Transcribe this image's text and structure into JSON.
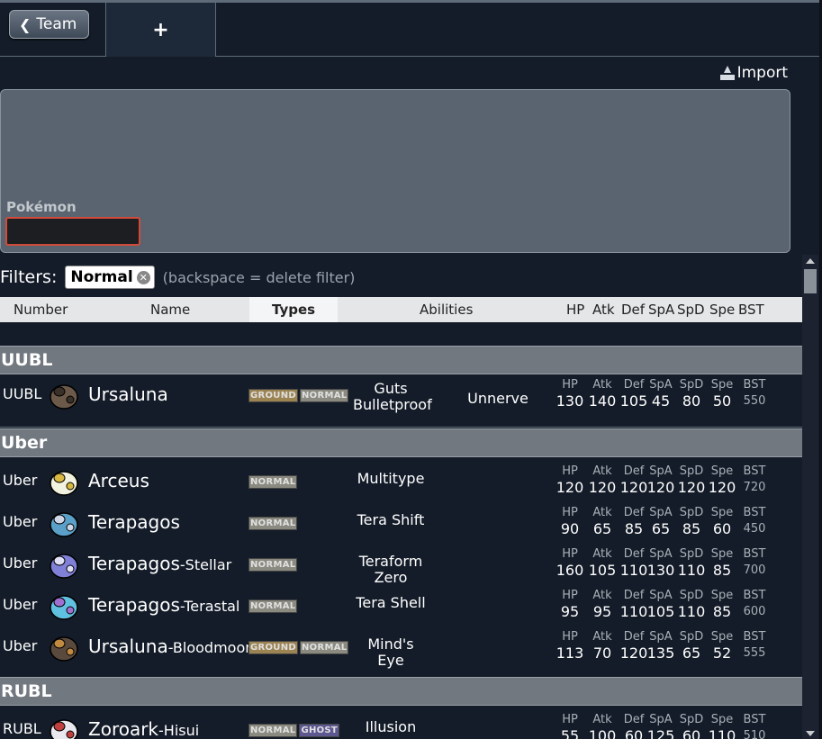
{
  "topbar": {
    "back_label": "Team",
    "add_tab_label": "+"
  },
  "import_label": "Import",
  "pokemon_label": "Pokémon",
  "filters": {
    "label": "Filters:",
    "chip": "Normal",
    "hint": "(backspace = delete filter)"
  },
  "columns": {
    "number": "Number",
    "name": "Name",
    "types": "Types",
    "abilities": "Abilities",
    "hp": "HP",
    "atk": "Atk",
    "def": "Def",
    "spa": "SpA",
    "spd": "SpD",
    "spe": "Spe",
    "bst": "BST"
  },
  "stat_labels": [
    "HP",
    "Atk",
    "Def",
    "SpA",
    "SpD",
    "Spe",
    "BST"
  ],
  "groups": [
    {
      "title": "UUBL",
      "rows": [
        {
          "tier": "UUBL",
          "name": "Ursaluna",
          "forme": "",
          "types": [
            "GROUND",
            "NORMAL"
          ],
          "ability1": "Guts",
          "ability1b": "Bulletproof",
          "ability2": "Unnerve",
          "stats": [
            "130",
            "140",
            "105",
            "45",
            "80",
            "50",
            "550"
          ],
          "sprite": "ursaluna-sprite"
        }
      ]
    },
    {
      "title": "Uber",
      "rows": [
        {
          "tier": "Uber",
          "name": "Arceus",
          "forme": "",
          "types": [
            "NORMAL"
          ],
          "ability1": "Multitype",
          "ability1b": "",
          "ability2": "",
          "stats": [
            "120",
            "120",
            "120",
            "120",
            "120",
            "120",
            "720"
          ],
          "sprite": "arceus-sprite"
        },
        {
          "tier": "Uber",
          "name": "Terapagos",
          "forme": "",
          "types": [
            "NORMAL"
          ],
          "ability1": "Tera Shift",
          "ability1b": "",
          "ability2": "",
          "stats": [
            "90",
            "65",
            "85",
            "65",
            "85",
            "60",
            "450"
          ],
          "sprite": "terapagos-sprite"
        },
        {
          "tier": "Uber",
          "name": "Terapagos",
          "forme": "-Stellar",
          "types": [
            "NORMAL"
          ],
          "ability1": "Teraform Zero",
          "ability1b": "",
          "ability2": "",
          "stats": [
            "160",
            "105",
            "110",
            "130",
            "110",
            "85",
            "700"
          ],
          "sprite": "terapagos-stellar-sprite"
        },
        {
          "tier": "Uber",
          "name": "Terapagos",
          "forme": "-Terastal",
          "types": [
            "NORMAL"
          ],
          "ability1": "Tera Shell",
          "ability1b": "",
          "ability2": "",
          "stats": [
            "95",
            "95",
            "110",
            "105",
            "110",
            "85",
            "600"
          ],
          "sprite": "terapagos-terastal-sprite"
        },
        {
          "tier": "Uber",
          "name": "Ursaluna",
          "forme": "-Bloodmoon",
          "types": [
            "GROUND",
            "NORMAL"
          ],
          "ability1": "Mind's Eye",
          "ability1b": "",
          "ability2": "",
          "stats": [
            "113",
            "70",
            "120",
            "135",
            "65",
            "52",
            "555"
          ],
          "sprite": "ursaluna-bloodmoon-sprite"
        }
      ]
    },
    {
      "title": "RUBL",
      "rows": [
        {
          "tier": "RUBL",
          "name": "Zoroark",
          "forme": "-Hisui",
          "types": [
            "NORMAL",
            "GHOST"
          ],
          "ability1": "Illusion",
          "ability1b": "",
          "ability2": "",
          "stats": [
            "55",
            "100",
            "60",
            "125",
            "60",
            "110",
            "510"
          ],
          "sprite": "zoroark-hisui-sprite"
        }
      ]
    }
  ],
  "colors": {
    "background": "#141c29",
    "group_bar": "#727880",
    "header_bg": "#e4e6e8",
    "input_border": "#d24a3a",
    "ground": "#9c8352",
    "normal": "#8a8a80",
    "ghost": "#5e5891"
  }
}
